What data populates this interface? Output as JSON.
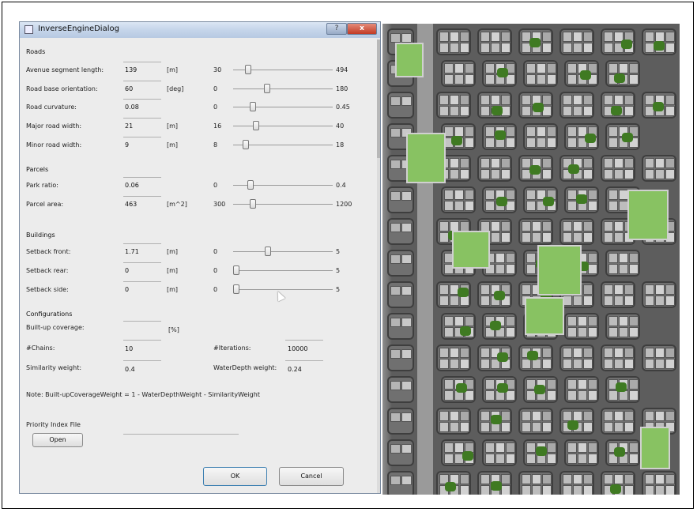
{
  "dialog": {
    "title": "InverseEngineDialog",
    "help_glyph": "?",
    "close_glyph": "x"
  },
  "sections": {
    "roads": "Roads",
    "parcels": "Parcels",
    "buildings": "Buildings",
    "configurations": "Configurations"
  },
  "sliders": [
    {
      "label": "Avenue segment length:",
      "value": "139",
      "unit": "[m]",
      "min": "30",
      "max": "494",
      "level": 0.13
    },
    {
      "label": "Road base orientation:",
      "value": "60",
      "unit": "[deg]",
      "min": "0",
      "max": "180",
      "level": 0.33
    },
    {
      "label": "Road curvature:",
      "value": "0.08",
      "unit": "",
      "min": "0",
      "max": "0.45",
      "level": 0.18
    },
    {
      "label": "Major road width:",
      "value": "21",
      "unit": "[m]",
      "min": "16",
      "max": "40",
      "level": 0.21
    },
    {
      "label": "Minor road width:",
      "value": "9",
      "unit": "[m]",
      "min": "8",
      "max": "18",
      "level": 0.1
    },
    {
      "label": "Park ratio:",
      "value": "0.06",
      "unit": "",
      "min": "0",
      "max": "0.4",
      "level": 0.15
    },
    {
      "label": "Parcel area:",
      "value": "463",
      "unit": "[m^2]",
      "min": "300",
      "max": "1200",
      "level": 0.18
    },
    {
      "label": "Setback front:",
      "value": "1.71",
      "unit": "[m]",
      "min": "0",
      "max": "5",
      "level": 0.34
    },
    {
      "label": "Setback rear:",
      "value": "0",
      "unit": "[m]",
      "min": "0",
      "max": "5",
      "level": 0.0
    },
    {
      "label": "Setback side:",
      "value": "0",
      "unit": "[m]",
      "min": "0",
      "max": "5",
      "level": 0.0
    }
  ],
  "config": {
    "builtup_label": "Built-up coverage:",
    "builtup_value": "",
    "builtup_unit": "[%]",
    "chains_label": "#Chains:",
    "chains_value": "10",
    "iterations_label": "#Iterations:",
    "iterations_value": "10000",
    "similarity_label": "Similarity weight:",
    "similarity_value": "0.4",
    "waterdepth_label": "WaterDepth weight:",
    "waterdepth_value": "0.24",
    "note": "Note: Built-upCoverageWeight = 1 - WaterDepthWeight - SimilarityWeight"
  },
  "priority": {
    "label": "Priority Index File",
    "open_label": "Open",
    "path_value": ""
  },
  "buttons": {
    "ok": "OK",
    "cancel": "Cancel"
  },
  "colors": {
    "park": "#88c262",
    "tree": "#3f7a22",
    "road": "#9a9a9a",
    "titlebar": "#c5d5ea"
  }
}
